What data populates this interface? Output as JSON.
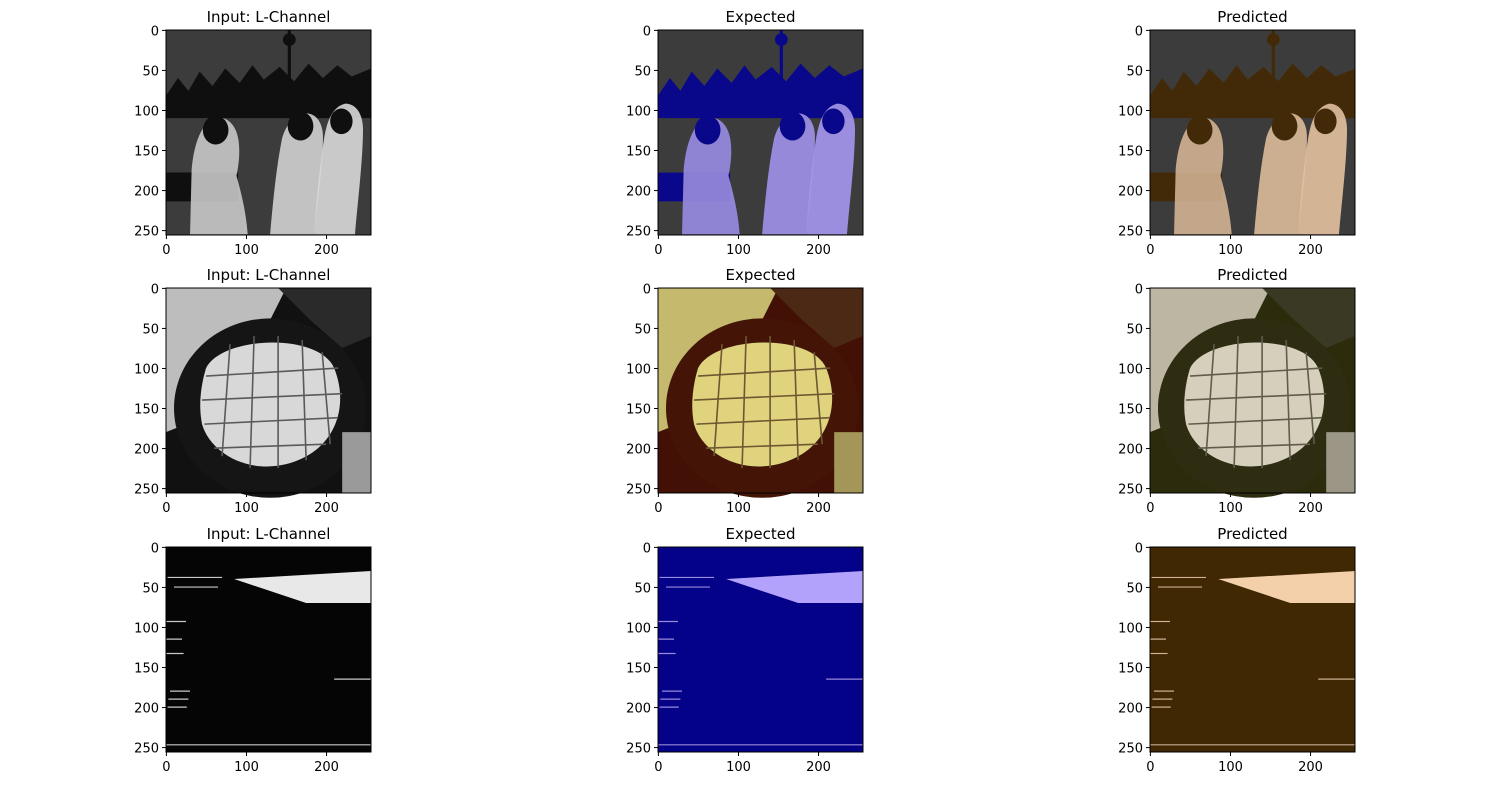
{
  "grid": {
    "titles": [
      "Input: L-Channel",
      "Expected",
      "Predicted"
    ],
    "panels": [
      {
        "title": "Input: L-Channel",
        "row": 0,
        "col": 0
      },
      {
        "title": "Expected",
        "row": 0,
        "col": 1
      },
      {
        "title": "Predicted",
        "row": 0,
        "col": 2
      },
      {
        "title": "Input: L-Channel",
        "row": 1,
        "col": 0
      },
      {
        "title": "Expected",
        "row": 1,
        "col": 1
      },
      {
        "title": "Predicted",
        "row": 1,
        "col": 2
      },
      {
        "title": "Input: L-Channel",
        "row": 2,
        "col": 0
      },
      {
        "title": "Expected",
        "row": 2,
        "col": 1
      },
      {
        "title": "Predicted",
        "row": 2,
        "col": 2
      }
    ],
    "x_ticks": [
      "0",
      "100",
      "200"
    ],
    "y_ticks": [
      "0",
      "50",
      "100",
      "150",
      "200",
      "250"
    ]
  }
}
